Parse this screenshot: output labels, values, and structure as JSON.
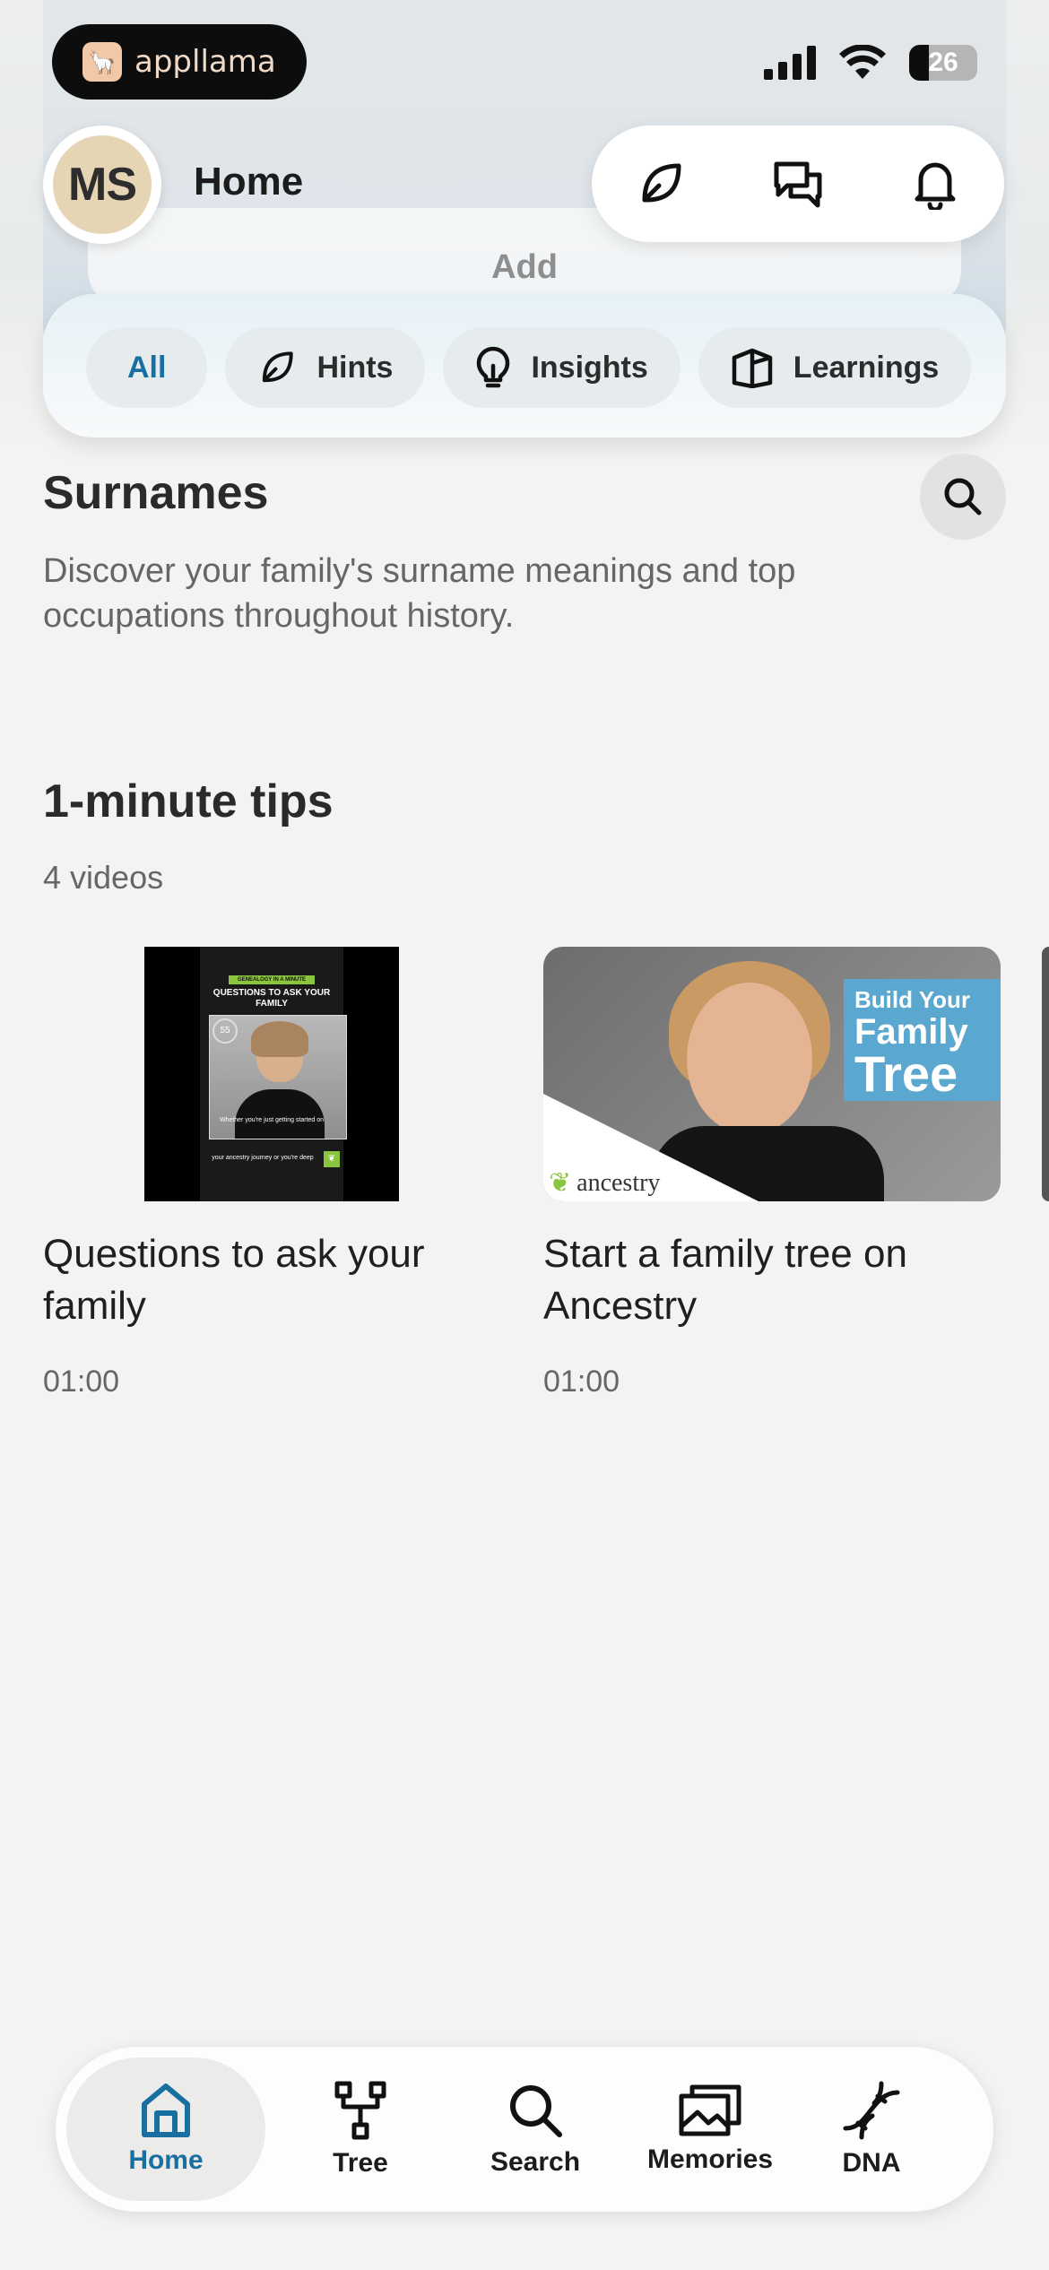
{
  "status_bar": {
    "app_badge": "appllama",
    "battery": "26"
  },
  "header": {
    "avatar_initials": "MS",
    "title": "Home",
    "add_label": "Add"
  },
  "filters": [
    {
      "label": "All",
      "icon": "none",
      "active": true
    },
    {
      "label": "Hints",
      "icon": "leaf-icon",
      "active": false
    },
    {
      "label": "Insights",
      "icon": "lightbulb-icon",
      "active": false
    },
    {
      "label": "Learnings",
      "icon": "book-icon",
      "active": false
    }
  ],
  "surnames": {
    "title": "Surnames",
    "description": "Discover your family's surname meanings and top occupations throughout history."
  },
  "tips": {
    "title": "1-minute tips",
    "count": "4 videos",
    "videos": [
      {
        "title": "Questions to ask your family",
        "duration": "01:00",
        "thumb_banner": "GENEALOGY IN A MINUTE",
        "thumb_heading": "QUESTIONS TO ASK YOUR FAMILY",
        "thumb_timer": "55",
        "thumb_caption1": "Whether you're just getting started on",
        "thumb_caption2": "your ancestry journey or you're deep"
      },
      {
        "title": "Start a family tree on Ancestry",
        "duration": "01:00",
        "thumb_line1": "Build Your",
        "thumb_line2": "Family",
        "thumb_line3": "Tree",
        "thumb_brand": "ancestry"
      }
    ]
  },
  "nav": [
    {
      "label": "Home",
      "icon": "home-icon",
      "active": true
    },
    {
      "label": "Tree",
      "icon": "tree-icon",
      "active": false
    },
    {
      "label": "Search",
      "icon": "search-icon",
      "active": false
    },
    {
      "label": "Memories",
      "icon": "memories-icon",
      "active": false
    },
    {
      "label": "DNA",
      "icon": "dna-icon",
      "active": false
    }
  ],
  "colors": {
    "accent": "#1a6fa1",
    "background": "#f4f3f1",
    "avatar": "#e6d5b4",
    "ancestry_green": "#8bc53f"
  }
}
